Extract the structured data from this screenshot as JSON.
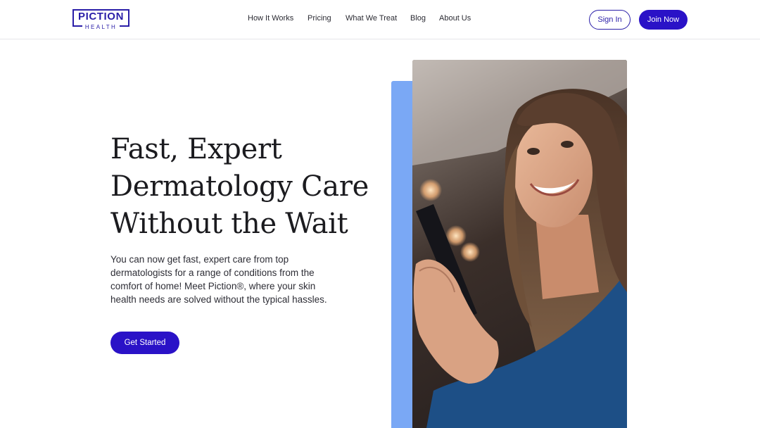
{
  "header": {
    "logo": {
      "main": "PICTION",
      "sub": "HEALTH"
    },
    "nav": [
      {
        "label": "How It Works"
      },
      {
        "label": "Pricing"
      },
      {
        "label": "What We Treat"
      },
      {
        "label": "Blog"
      },
      {
        "label": "About Us"
      }
    ],
    "sign_in_label": "Sign In",
    "join_label": "Join Now"
  },
  "hero": {
    "title_lines": [
      "Fast, Expert",
      "Dermatology Care",
      "Without the Wait"
    ],
    "description": "You can now get fast, expert care from top dermatologists for a range of conditions from the comfort of home! Meet Piction®, where your skin health needs are solved without the typical hassles.",
    "cta_label": "Get Started"
  },
  "colors": {
    "brand": "#2a1ea8",
    "button": "#2a12c7",
    "accent_panel": "#7aa8f5"
  }
}
